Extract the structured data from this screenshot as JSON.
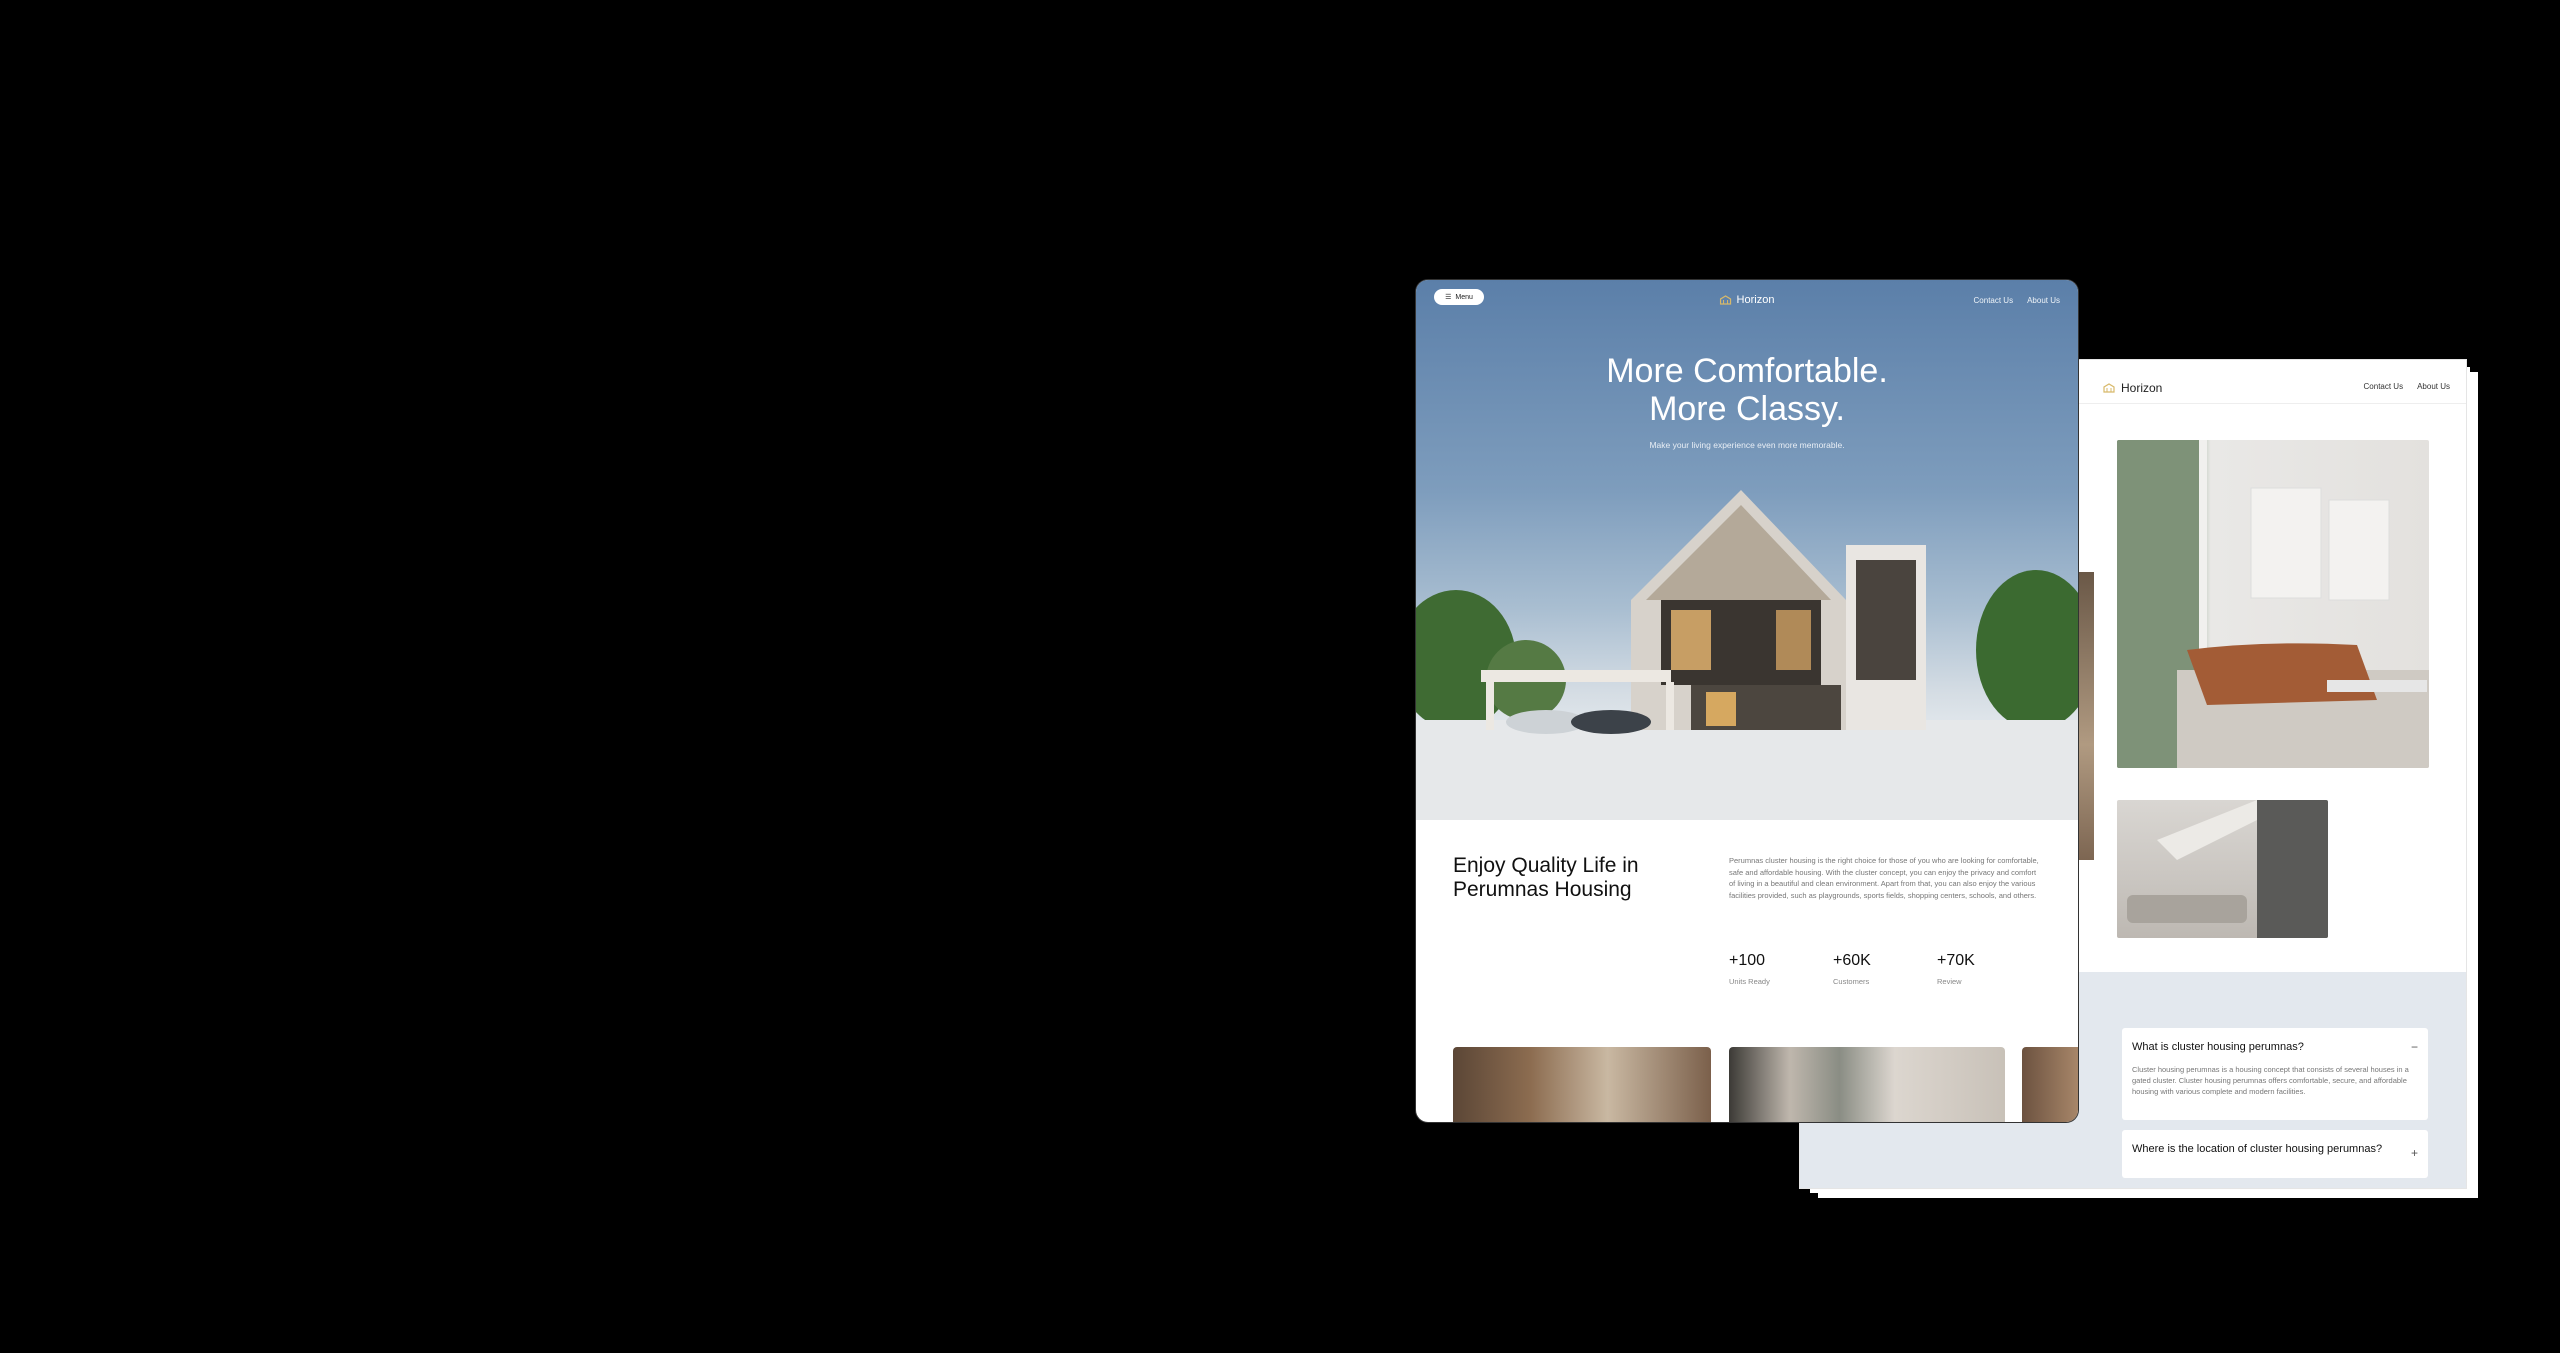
{
  "brand": "Horizon",
  "hero_nav": {
    "menu_label": "Menu",
    "links": [
      "Contact Us",
      "About Us"
    ]
  },
  "hero": {
    "title_line1": "More Comfortable.",
    "title_line2": "More Classy.",
    "subtitle": "Make your living experience even more memorable."
  },
  "intro": {
    "title": "Enjoy Quality Life in Perumnas Housing",
    "text": "Perumnas cluster housing is the right choice for those of you who are looking for comfortable, safe and affordable housing. With the cluster concept, you can enjoy the privacy and comfort of living in a beautiful and clean environment. Apart from that, you can also enjoy the various facilities provided, such as playgrounds, sports fields, shopping centers, schools, and others."
  },
  "stats": [
    {
      "value": "+100",
      "label": "Units Ready"
    },
    {
      "value": "+60K",
      "label": "Customers"
    },
    {
      "value": "+70K",
      "label": "Review"
    }
  ],
  "page2": {
    "links": [
      "Contact Us",
      "About Us"
    ],
    "faq": [
      {
        "question": "What is cluster housing perumnas?",
        "answer": "Cluster housing perumnas is a housing concept that consists of several houses in a gated cluster. Cluster housing perumnas offers comfortable, secure, and affordable housing with various complete and modern facilities.",
        "toggle": "−"
      },
      {
        "question": "Where is the location of cluster housing perumnas?",
        "toggle": "+"
      }
    ]
  },
  "colors": {
    "sky_top": "#5b7fa9",
    "accent_logo": "#d8b96a",
    "faq_bg": "#e3e8ee"
  }
}
